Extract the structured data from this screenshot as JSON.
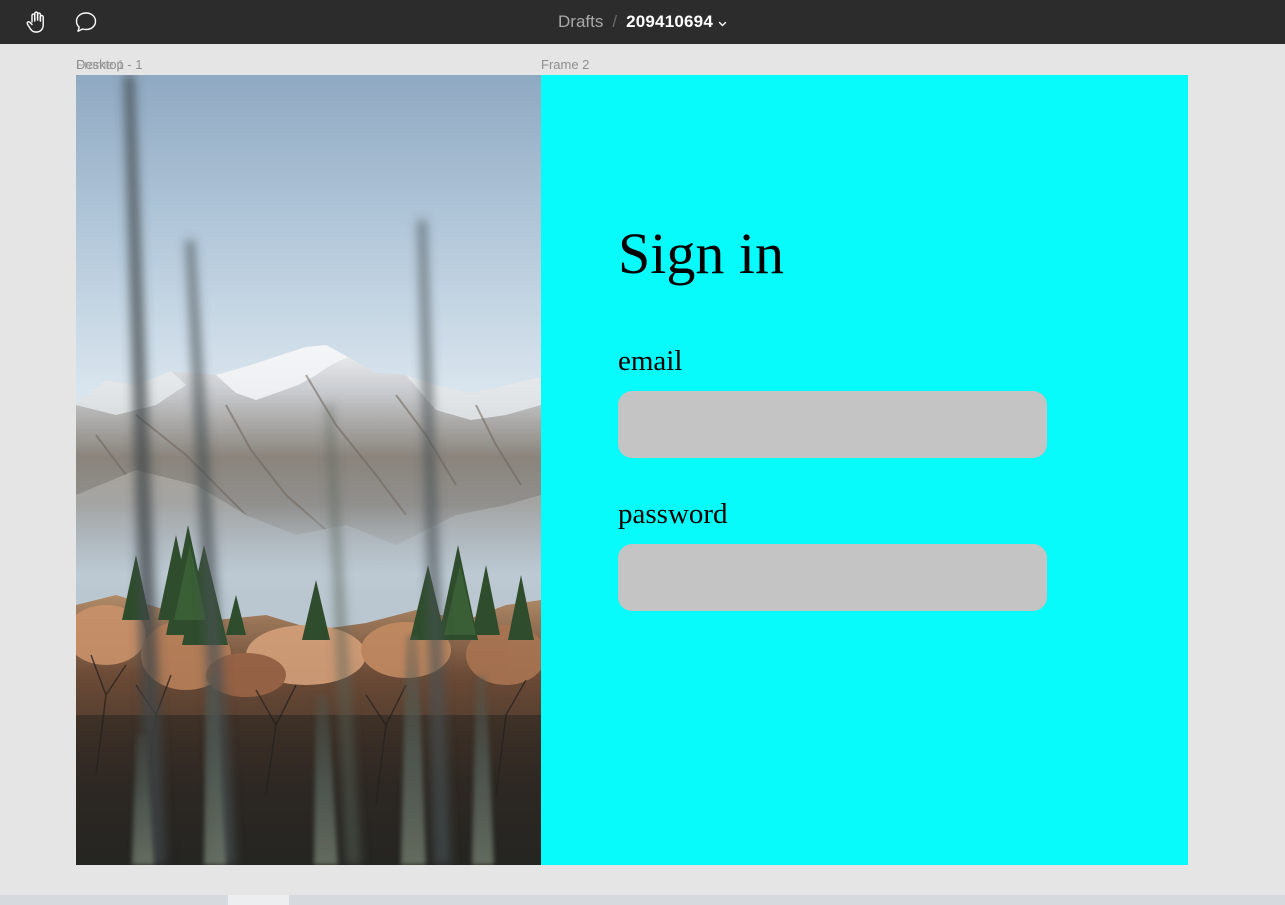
{
  "toolbar": {
    "tools": [
      {
        "name": "hand-tool",
        "icon": "hand-icon"
      },
      {
        "name": "comment-tool",
        "icon": "comment-icon"
      }
    ],
    "breadcrumb": {
      "folder": "Drafts",
      "separator": "/",
      "file": "209410694"
    }
  },
  "canvas": {
    "frame_labels": [
      "Desktop - 1",
      "Frame 1",
      "Frame 2"
    ],
    "frame_two": {
      "background": "#08fbfb",
      "title": "Sign in",
      "email_label": "email",
      "email_value": "",
      "password_label": "password",
      "password_value": "",
      "input_color": "#c4c4c4"
    },
    "desktop_image": "mountain-landscape-image"
  }
}
